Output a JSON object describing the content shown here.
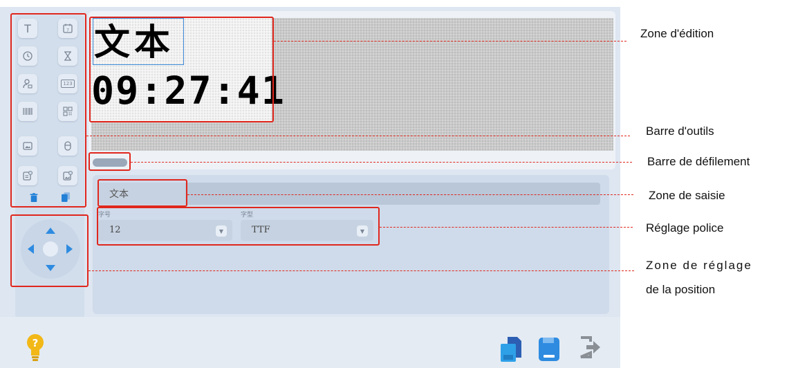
{
  "editor": {
    "preview_line1": "文本",
    "preview_line2": "09:27:41"
  },
  "input": {
    "value": "文本"
  },
  "font_settings": {
    "size_label": "字号",
    "size_value": "12",
    "type_label": "字型",
    "type_value": "TTF"
  },
  "toolbar": {
    "text_icon_glyph": "T",
    "counter_icon_glyph": "123"
  },
  "annotations": {
    "edit_zone": "Zone d'édition",
    "toolbar": "Barre d'outils",
    "scrollbar": "Barre de défilement",
    "input_zone": "Zone de saisie",
    "font_setting": "Réglage police",
    "position_line1": "Zone de réglage",
    "position_line2": "de la position"
  },
  "colors": {
    "annotation": "#e0261c",
    "selection": "#3a8ad8",
    "bulb": "#f2b817",
    "save": "#2e8be0",
    "accent_blue": "#2280d6"
  }
}
